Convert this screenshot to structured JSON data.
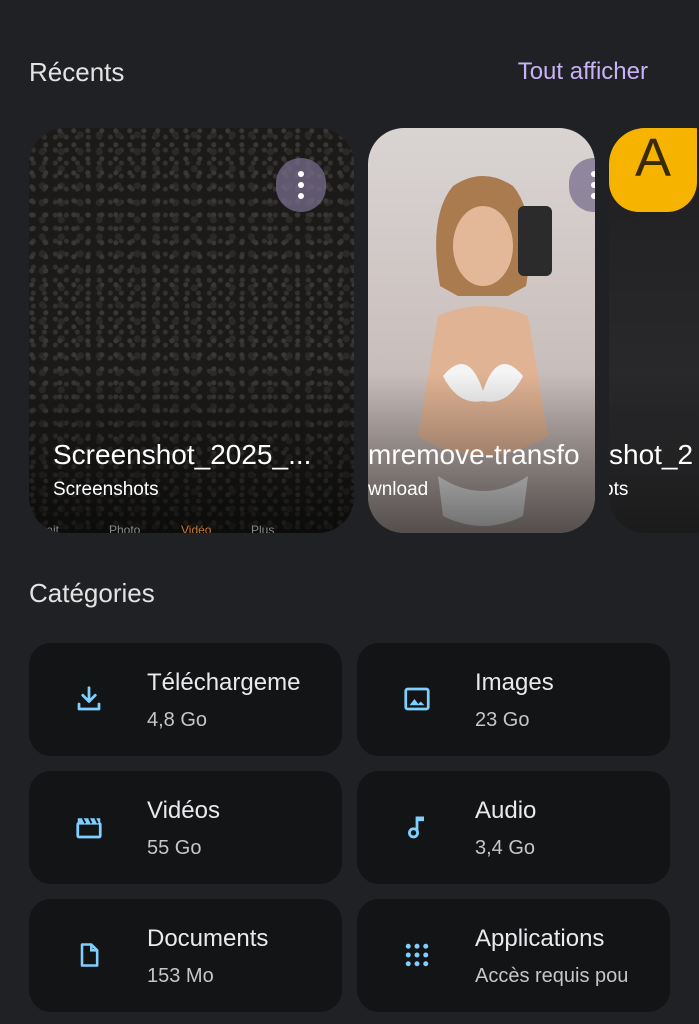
{
  "recents": {
    "title": "Récents",
    "view_all": "Tout afficher",
    "items": [
      {
        "name": "Screenshot_2025_...",
        "folder": "Screenshots",
        "icon": "more-vert-icon"
      },
      {
        "name": "mremove-transfo",
        "folder": "wnload",
        "icon": "more-vert-icon"
      },
      {
        "name": "shot_2",
        "folder": "ots",
        "icon": "avatar-letter",
        "letter": "A"
      }
    ],
    "camera_modes": [
      "rtrait",
      "Photo",
      "Vidéo",
      "Plus"
    ]
  },
  "categories": {
    "title": "Catégories",
    "items": [
      {
        "name": "Téléchargeme",
        "size": "4,8 Go",
        "icon": "download-icon"
      },
      {
        "name": "Images",
        "size": "23 Go",
        "icon": "image-icon"
      },
      {
        "name": "Vidéos",
        "size": "55 Go",
        "icon": "video-clapper-icon"
      },
      {
        "name": "Audio",
        "size": "3,4 Go",
        "icon": "music-note-icon"
      },
      {
        "name": "Documents",
        "size": "153 Mo",
        "icon": "document-icon"
      },
      {
        "name": "Applications",
        "size": "Accès requis pou",
        "icon": "apps-grid-icon"
      }
    ]
  },
  "colors": {
    "background": "#202124",
    "tile": "#131416",
    "accent": "#c8b2f5",
    "icon": "#7fcfff"
  }
}
